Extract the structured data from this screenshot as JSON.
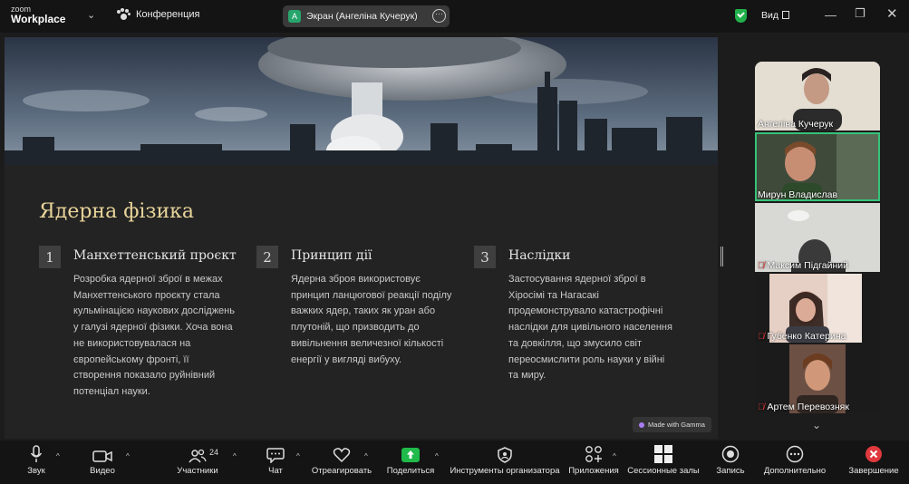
{
  "titlebar": {
    "logo_line1": "zoom",
    "logo_line2": "Workplace",
    "meeting_label": "Конференция",
    "screen_share_label": "Экран (Ангеліна Кучерук)",
    "screen_share_avatar": "A",
    "view_label": "Вид",
    "icons": [
      "chevron-down-icon",
      "paw-icon",
      "more-icon",
      "shield-check-icon",
      "grid-icon",
      "minimize-icon",
      "restore-icon",
      "close-icon"
    ]
  },
  "slide": {
    "title": "Ядерна фізика",
    "columns": [
      {
        "num": "1",
        "title": "Манхеттенський проєкт",
        "lines": [
          "Розробка ядерної зброї в межах",
          "Манхеттенського проєкту стала",
          "кульмінацією наукових досліджень",
          "у галузі ядерної фізики. Хоча вона",
          "не використовувалася на",
          "європейському фронті, її",
          "створення показало руйнівний",
          "потенціал науки."
        ]
      },
      {
        "num": "2",
        "title": "Принцип дії",
        "lines": [
          "Ядерна зброя використовує",
          "принцип ланцюгової реакції поділу",
          "важких ядер, таких як уран або",
          "плутоній, що призводить до",
          "вивільнення величезної кількості",
          "енергії у вигляді вибуху."
        ]
      },
      {
        "num": "3",
        "title": "Наслідки",
        "lines": [
          "Застосування ядерної зброї в",
          "Хіросімі та Нагасакі",
          "продемонструвало катастрофічні",
          "наслідки для цивільного населення",
          "та довкілля, що змусило світ",
          "переосмислити роль науки у війні",
          "та миру."
        ]
      }
    ],
    "gamma_badge": "Made with Gamma"
  },
  "participants": [
    {
      "name": "Ангеліна Кучерук",
      "muted": false,
      "active": false
    },
    {
      "name": "Мирун Владислав",
      "muted": false,
      "active": true
    },
    {
      "name": "Максим Підгайний",
      "muted": true,
      "active": false
    },
    {
      "name": "Губенко Катерина",
      "muted": true,
      "active": false
    },
    {
      "name": "Артем Перевозняк",
      "muted": true,
      "active": false
    }
  ],
  "toolbar": {
    "items": [
      {
        "label": "Звук",
        "icon": "microphone-icon"
      },
      {
        "label": "Видео",
        "icon": "video-camera-icon"
      },
      {
        "label": "Участники",
        "icon": "participants-icon",
        "count": "24"
      },
      {
        "label": "Чат",
        "icon": "chat-icon"
      },
      {
        "label": "Отреагировать",
        "icon": "heart-icon"
      },
      {
        "label": "Поделиться",
        "icon": "share-screen-icon"
      },
      {
        "label": "Инструменты организатора",
        "icon": "host-tools-icon"
      },
      {
        "label": "Приложения",
        "icon": "apps-icon"
      },
      {
        "label": "Сессионные залы",
        "icon": "breakout-rooms-icon"
      },
      {
        "label": "Запись",
        "icon": "record-icon"
      },
      {
        "label": "Дополнительно",
        "icon": "more-icon"
      },
      {
        "label": "Завершение",
        "icon": "end-icon"
      }
    ]
  },
  "colors": {
    "accent_green": "#37c27a",
    "share_green": "#1fba4a",
    "end_red": "#e0393e",
    "title_gold": "#e8d49a"
  }
}
